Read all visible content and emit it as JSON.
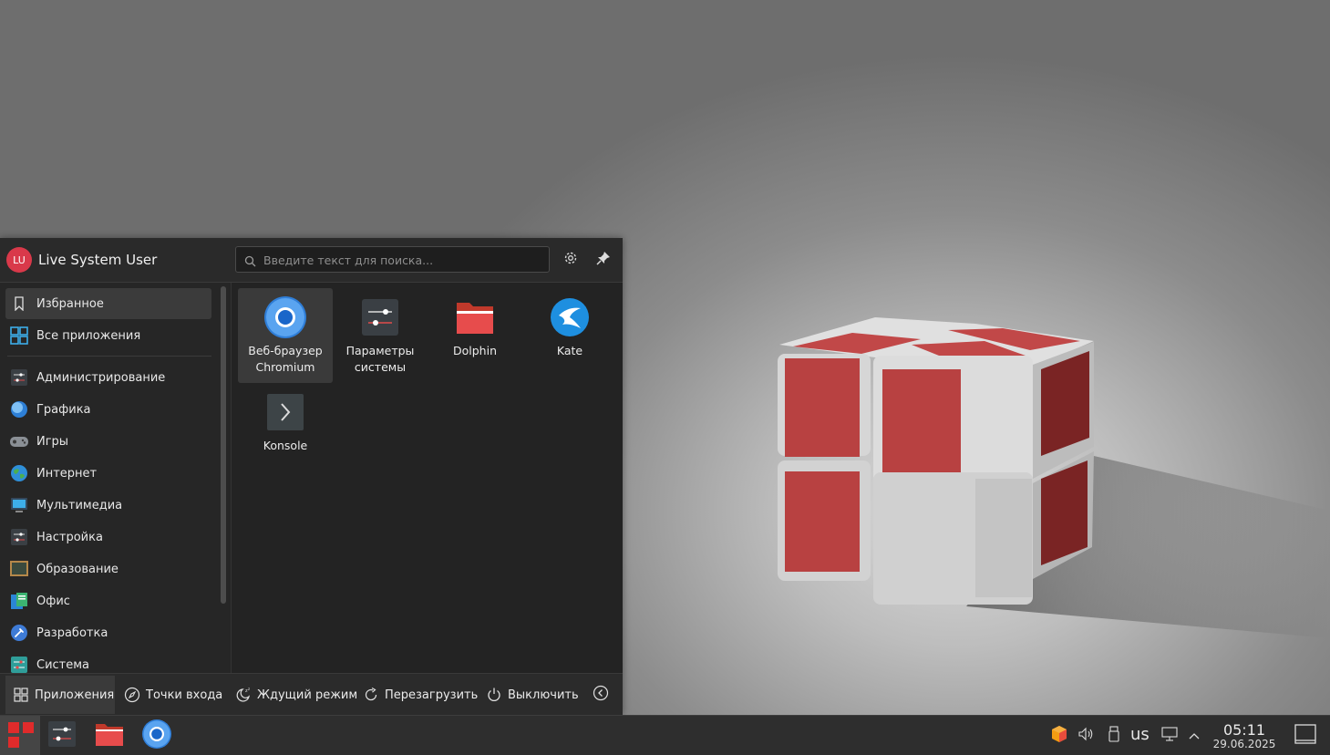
{
  "launcher": {
    "user": {
      "initials": "LU",
      "name": "Live System User"
    },
    "search": {
      "placeholder": "Введите текст для поиска..."
    },
    "categories": [
      {
        "label": "Избранное",
        "icon": "bookmark-icon"
      },
      {
        "label": "Все приложения",
        "icon": "grid-icon"
      },
      {
        "label": "Администрирование",
        "icon": "admin-icon"
      },
      {
        "label": "Графика",
        "icon": "graphics-icon"
      },
      {
        "label": "Игры",
        "icon": "gamepad-icon"
      },
      {
        "label": "Интернет",
        "icon": "globe-icon"
      },
      {
        "label": "Мультимедиа",
        "icon": "multimedia-icon"
      },
      {
        "label": "Настройка",
        "icon": "settings-sliders-icon"
      },
      {
        "label": "Образование",
        "icon": "chalkboard-icon"
      },
      {
        "label": "Офис",
        "icon": "office-icon"
      },
      {
        "label": "Разработка",
        "icon": "development-icon"
      },
      {
        "label": "Система",
        "icon": "system-icon"
      }
    ],
    "apps": [
      {
        "label": "Веб-браузер Chromium",
        "icon": "chromium-icon"
      },
      {
        "label": "Параметры системы",
        "icon": "system-settings-icon"
      },
      {
        "label": "Dolphin",
        "icon": "folder-icon"
      },
      {
        "label": "Kate",
        "icon": "kate-icon"
      },
      {
        "label": "Konsole",
        "icon": "terminal-icon"
      }
    ],
    "footer": {
      "apps_tab": "Приложения",
      "places_tab": "Точки входа",
      "sleep": "Ждущий режим",
      "restart": "Перезагрузить",
      "shutdown": "Выключить"
    }
  },
  "taskbar": {
    "keyboard_layout": "us",
    "time": "05:11",
    "date": "29.06.2025"
  },
  "colors": {
    "accent": "#d9394a",
    "panel": "#232323",
    "taskbar": "#2e2e2e"
  }
}
